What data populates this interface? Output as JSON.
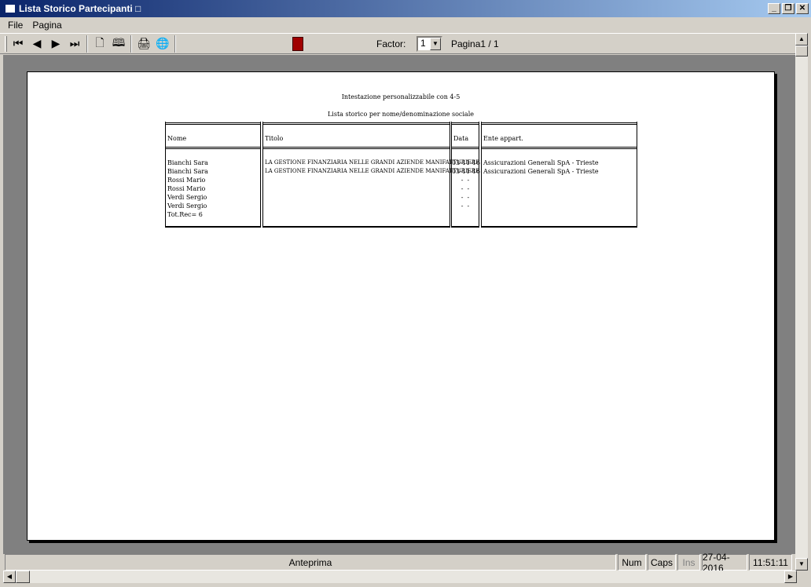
{
  "window": {
    "title": "Lista Storico Partecipanti □"
  },
  "menu": [
    "File",
    "Pagina"
  ],
  "toolbar": {
    "factor_label": "Factor:",
    "factor_value": "1",
    "page_label": "Pagina1 / 1"
  },
  "report": {
    "header_line1": "Intestazione personalizzabile con 4-5",
    "header_line2": "Lista storico per nome/denominazione sociale",
    "columns": [
      "Nome",
      "Titolo",
      "Data",
      "Ente appart."
    ],
    "col_nome": "Bianchi Sara\nBianchi Sara\nRossi Mario\nRossi Mario\nVerdi Sergio\nVerdi Sergio\nTot.Rec= 6",
    "col_titolo": "LA GESTIONE FINANZIARIA NELLE GRANDI AZIENDE MANIFATTURIERE\nLA GESTIONE FINANZIARIA NELLE GRANDI AZIENDE MANIFATTURIERE",
    "col_data": "03-11-16\n03-11-16\n-  -\n-  -\n-  -\n-  -",
    "col_ente": "Assicurazioni Generali SpA - Trieste\nAssicurazioni Generali SpA - Trieste"
  },
  "statusbar": {
    "message": "Anteprima",
    "num": "Num",
    "caps": "Caps",
    "ins": "Ins",
    "date": "27-04-2016",
    "time": "11:51:11"
  }
}
